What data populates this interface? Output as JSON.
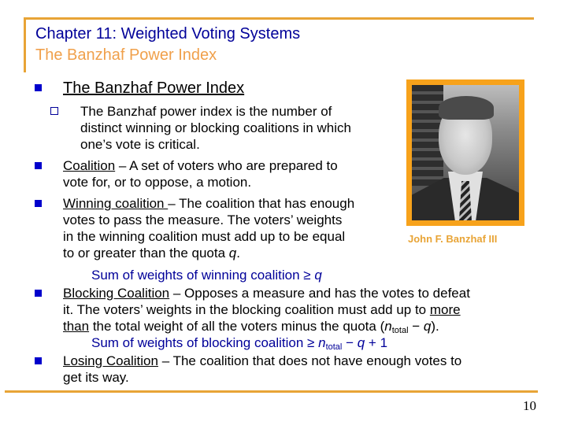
{
  "header": {
    "title": "Chapter 11:  Weighted Voting Systems",
    "subtitle": "The Banzhaf Power Index"
  },
  "colors": {
    "title": "#000099",
    "subtitle": "#F0A04B",
    "accent_rule": "#E8A436",
    "bullet": "#0000CC",
    "photo_frame": "#F7A21B"
  },
  "bullets": {
    "b1": {
      "heading": "The Banzhaf Power Index",
      "sub1": {
        "l1": "The Banzhaf power index is the number of",
        "l2": "distinct winning or blocking coalitions in which",
        "l3": "one’s vote is critical."
      }
    },
    "b2": {
      "term": "Coalition",
      "l1_rest": " – A set of voters who are prepared to",
      "l2": "vote for, or to oppose, a motion."
    },
    "b3": {
      "term": "Winning coalition ",
      "l1_rest": "– The coalition that has enough",
      "l2": "votes to pass the measure.  The voters’ weights",
      "l3": "in the winning coalition must add up to be equal",
      "l4_a": "to or greater than the quota ",
      "l4_q": "q",
      "l4_b": ".",
      "formula_a": "Sum of weights of winning coalition ≥ ",
      "formula_q": "q"
    },
    "b4": {
      "term": "Blocking Coalition",
      "l1_rest": " – Opposes a measure and has the votes to defeat",
      "l2_a": "it. The voters’ weights in the blocking coalition must add up to ",
      "l2_u": "more",
      "l3_u": "than",
      "l3_a": " the total weight of all the voters minus the quota  (",
      "l3_n": "n",
      "l3_sub": "total",
      "l3_b": " − ",
      "l3_q": "q",
      "l3_c": ").",
      "formula_a": "Sum of weights of blocking coalition ≥ ",
      "formula_n": "n",
      "formula_sub": "total",
      "formula_b": " − ",
      "formula_q": "q",
      "formula_c": " + 1"
    },
    "b5": {
      "term": "Losing Coalition",
      "l1_rest": " – The coalition that does not have enough votes to",
      "l2": "get its way."
    }
  },
  "photo": {
    "caption": "John F. Banzhaf III"
  },
  "footer": {
    "page_number": "10"
  }
}
